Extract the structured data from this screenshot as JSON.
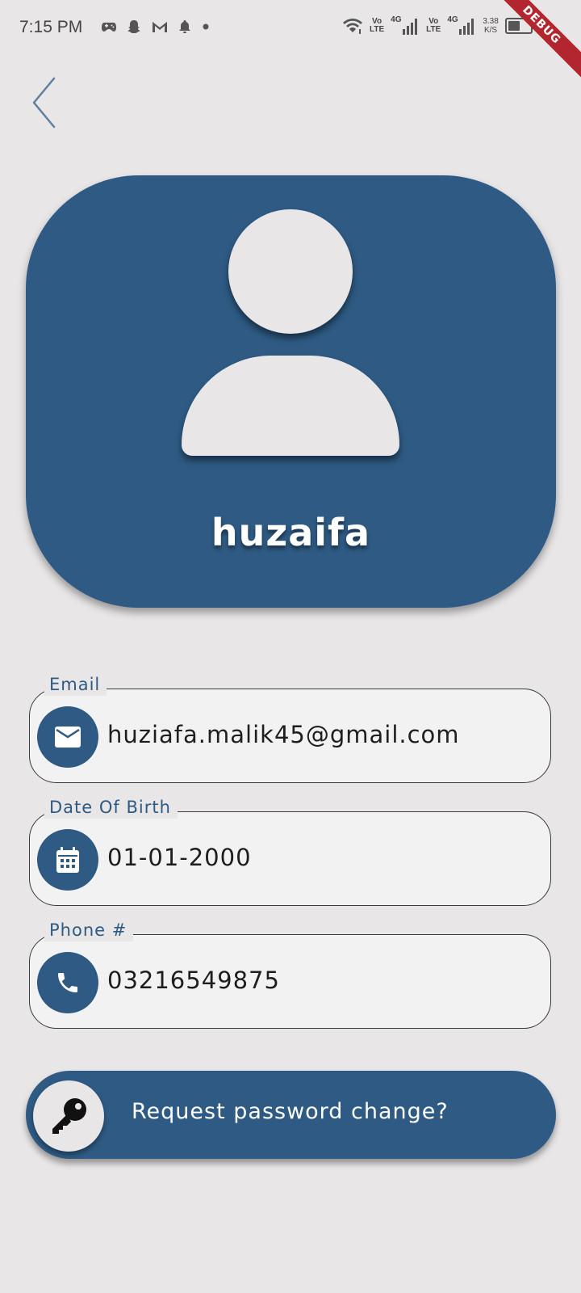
{
  "status_bar": {
    "time": "7:15 PM",
    "net1": [
      "Vo",
      "LTE"
    ],
    "net2": [
      "Vo",
      "LTE"
    ],
    "gen1": "4G",
    "gen2": "4G",
    "speed_value": "3.38",
    "speed_unit": "K/S",
    "battery_percent": 55,
    "debug_label": "DEBUG",
    "icons_left": [
      "game-icon",
      "snapchat-icon",
      "gmail-icon",
      "notification-bell-icon",
      "dot-icon"
    ],
    "icons_right": [
      "wifi-icon",
      "signal-icon",
      "battery-icon"
    ]
  },
  "colors": {
    "primary": "#2e5a83",
    "background": "#e8e6e7",
    "field_background": "#f3f2f3",
    "text": "#1e1e1e",
    "debug_ribbon": "#b3262f"
  },
  "profile": {
    "name": "huzaifa",
    "icon": "person-avatar-icon"
  },
  "fields": [
    {
      "label": "Email",
      "value": "huziafa.malik45@gmail.com",
      "icon": "mail-icon"
    },
    {
      "label": "Date Of Birth",
      "value": "01-01-2000",
      "icon": "calendar-icon"
    },
    {
      "label": "Phone #",
      "value": "03216549875",
      "icon": "phone-icon"
    }
  ],
  "password_button": {
    "label": "Request password change?",
    "icon": "key-icon"
  }
}
